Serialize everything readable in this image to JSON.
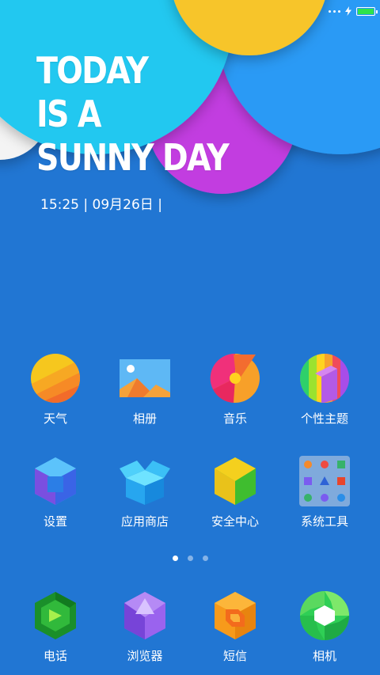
{
  "status_bar": {
    "battery_color": "#2ee34a"
  },
  "wallpaper": {
    "headline_lines": [
      "TODAY",
      "IS A",
      "SUNNY DAY"
    ],
    "datetime": "15:25 | 09月26日 |"
  },
  "grid_apps": [
    {
      "label": "天气",
      "icon": "weather-icon"
    },
    {
      "label": "相册",
      "icon": "gallery-icon"
    },
    {
      "label": "音乐",
      "icon": "music-icon"
    },
    {
      "label": "个性主题",
      "icon": "themes-icon"
    },
    {
      "label": "设置",
      "icon": "settings-icon"
    },
    {
      "label": "应用商店",
      "icon": "app-store-icon"
    },
    {
      "label": "安全中心",
      "icon": "security-center-icon"
    },
    {
      "label": "系统工具",
      "icon": "system-tools-folder-icon"
    }
  ],
  "page_indicator": {
    "count": 3,
    "active": 1
  },
  "dock_apps": [
    {
      "label": "电话",
      "icon": "phone-icon"
    },
    {
      "label": "浏览器",
      "icon": "browser-icon"
    },
    {
      "label": "短信",
      "icon": "messages-icon"
    },
    {
      "label": "相机",
      "icon": "camera-icon"
    }
  ]
}
